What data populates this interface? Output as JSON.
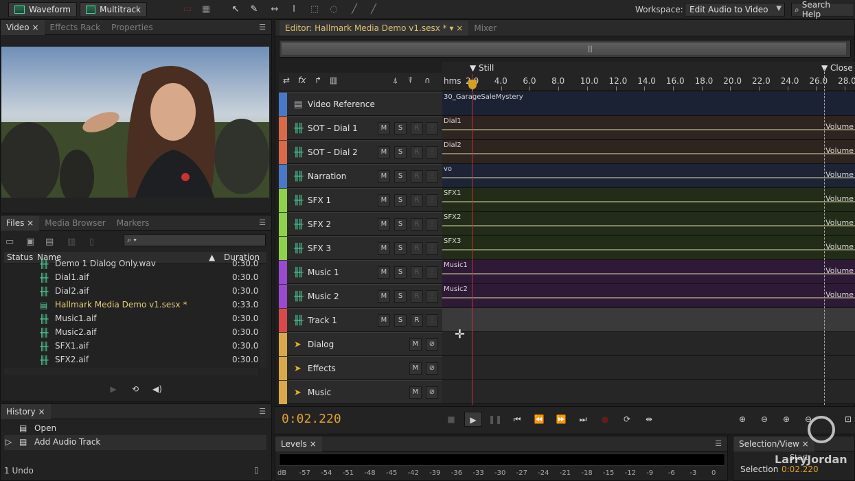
{
  "toolbar": {
    "waveform_label": "Waveform",
    "multitrack_label": "Multitrack",
    "workspace_label": "Workspace:",
    "workspace_value": "Edit Audio to Video",
    "search_help": "Search Help"
  },
  "video_panel": {
    "tabs": [
      "Video",
      "Effects Rack",
      "Properties"
    ]
  },
  "files_panel": {
    "tabs": [
      "Files",
      "Media Browser",
      "Markers"
    ],
    "columns": {
      "status": "Status",
      "name": "Name",
      "duration": "Duration"
    },
    "search_placeholder": "",
    "files": [
      {
        "name": "Demo 1 Dialog Only.wav",
        "duration": "0:30.0",
        "kind": "audio"
      },
      {
        "name": "Dial1.aif",
        "duration": "0:30.0",
        "kind": "audio"
      },
      {
        "name": "Dial2.aif",
        "duration": "0:30.0",
        "kind": "audio"
      },
      {
        "name": "Hallmark Media Demo v1.sesx *",
        "duration": "0:33.0",
        "kind": "session"
      },
      {
        "name": "Music1.aif",
        "duration": "0:30.0",
        "kind": "audio"
      },
      {
        "name": "Music2.aif",
        "duration": "0:30.0",
        "kind": "audio"
      },
      {
        "name": "SFX1.aif",
        "duration": "0:30.0",
        "kind": "audio"
      },
      {
        "name": "SFX2.aif",
        "duration": "0:30.0",
        "kind": "audio"
      }
    ]
  },
  "history_panel": {
    "tab": "History",
    "items": [
      "Open",
      "Add Audio Track"
    ],
    "undo_count": "1 Undo"
  },
  "editor": {
    "tab_label": "Editor: Hallmark Media Demo v1.sesx *",
    "mixer_tab": "Mixer",
    "ruler_unit": "hms",
    "ruler_ticks": [
      "2.0",
      "4.0",
      "6.0",
      "8.0",
      "10.0",
      "12.0",
      "14.0",
      "16.0",
      "18.0",
      "20.0",
      "22.0",
      "24.0",
      "26.0",
      "28.0"
    ],
    "marker_start": "Still",
    "marker_end": "Close",
    "tracks": [
      {
        "name": "Video Reference",
        "type": "video",
        "color": "#4a78c8",
        "clip": "30_GarageSaleMystery",
        "lane_color": "#1b2233"
      },
      {
        "name": "SOT – Dial 1",
        "type": "audio",
        "color": "#d86a4a",
        "clip": "Dial1",
        "lane_color": "#2e2420"
      },
      {
        "name": "SOT – Dial 2",
        "type": "audio",
        "color": "#d86a4a",
        "clip": "Dial2",
        "lane_color": "#2e2420"
      },
      {
        "name": "Narration",
        "type": "audio",
        "color": "#4a78c8",
        "clip": "vo",
        "lane_color": "#1c2436"
      },
      {
        "name": "SFX 1",
        "type": "audio",
        "color": "#8ed04a",
        "clip": "SFX1",
        "lane_color": "#222c18"
      },
      {
        "name": "SFX 2",
        "type": "audio",
        "color": "#8ed04a",
        "clip": "SFX2",
        "lane_color": "#222c18"
      },
      {
        "name": "SFX 3",
        "type": "audio",
        "color": "#8ed04a",
        "clip": "SFX3",
        "lane_color": "#222c18"
      },
      {
        "name": "Music 1",
        "type": "audio",
        "color": "#9a4ad0",
        "clip": "Music1",
        "lane_color": "#2e1a36"
      },
      {
        "name": "Music 2",
        "type": "audio",
        "color": "#9a4ad0",
        "clip": "Music2",
        "lane_color": "#2e1a36"
      },
      {
        "name": "Track 1",
        "type": "audio",
        "color": "#d84a4a",
        "clip": "",
        "lane_color": "#3a3a3a"
      },
      {
        "name": "Dialog",
        "type": "bus",
        "color": "#d8a84a",
        "clip": "",
        "lane_color": "#262626"
      },
      {
        "name": "Effects",
        "type": "bus",
        "color": "#d8a84a",
        "clip": "",
        "lane_color": "#262626"
      },
      {
        "name": "Music",
        "type": "bus",
        "color": "#d8a84a",
        "clip": "",
        "lane_color": "#262626"
      }
    ],
    "volume_label": "Volume",
    "btn_m": "M",
    "btn_s": "S",
    "btn_r": "R",
    "video_ref_icon": "film-icon"
  },
  "transport": {
    "timecode": "0:02.220"
  },
  "levels": {
    "tab": "Levels",
    "scale": [
      "dB",
      "-57",
      "-54",
      "-51",
      "-48",
      "-45",
      "-42",
      "-39",
      "-36",
      "-33",
      "-30",
      "-27",
      "-24",
      "-21",
      "-18",
      "-15",
      "-12",
      "-9",
      "-6",
      "-3",
      "0"
    ]
  },
  "selection_view": {
    "tab": "Selection/View",
    "start_header": "Start",
    "selection_label": "Selection",
    "selection_value": "0:02.220",
    "watermark": "LarryJordan"
  }
}
